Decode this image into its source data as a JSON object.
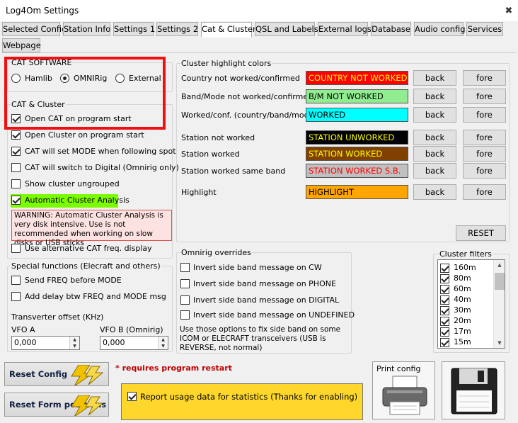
{
  "window": {
    "title": "Log4Om Settings",
    "close_glyph": "✖"
  },
  "tabs": [
    {
      "label": "Selected Config"
    },
    {
      "label": "Station Info"
    },
    {
      "label": "Settings 1"
    },
    {
      "label": "Settings 2"
    },
    {
      "label": "Cat & Cluster",
      "active": true
    },
    {
      "label": "QSL and Labels"
    },
    {
      "label": "External logs"
    },
    {
      "label": "Database"
    },
    {
      "label": "Audio config"
    },
    {
      "label": "Services"
    },
    {
      "label": "Webpage"
    }
  ],
  "cat_software": {
    "title": "CAT SOFTWARE",
    "options": [
      {
        "label": "Hamlib",
        "selected": false
      },
      {
        "label": "OMNIRig",
        "selected": true
      },
      {
        "label": "External",
        "selected": false
      }
    ]
  },
  "cat_cluster": {
    "title": "CAT & Cluster",
    "options": [
      {
        "label": "Open CAT on program start",
        "checked": true
      },
      {
        "label": "Open Cluster on program start",
        "checked": true
      },
      {
        "label": "CAT will set MODE when following spot",
        "checked": true
      },
      {
        "label": "CAT will switch to Digital (Omnirig only)",
        "checked": false
      },
      {
        "label": "Show cluster ungrouped",
        "checked": false
      },
      {
        "label": "Automatic Cluster Analysis",
        "checked": true
      }
    ],
    "warning": "WARNING: Automatic Cluster Analysis is very disk intensive. Use is not recommended when working on slow disks or USB sticks",
    "alt_freq": {
      "label": "Use alternative CAT freq. display",
      "checked": false
    }
  },
  "special": {
    "title": "Special functions (Elecraft and others)",
    "options": [
      {
        "label": "Send FREQ before MODE",
        "checked": false
      },
      {
        "label": "Add delay btw FREQ and MODE msg",
        "checked": false
      }
    ],
    "transverter_label": "Transverter offset (KHz)",
    "vfo_a_label": "VFO A",
    "vfo_a_value": "0,000",
    "vfo_b_label": "VFO B (Omnirig)",
    "vfo_b_value": "0,000"
  },
  "highlight": {
    "title": "Cluster highlight colors",
    "back_label": "back",
    "fore_label": "fore",
    "reset_label": "RESET",
    "rows": [
      {
        "label": "Country not worked/confirmed",
        "sample": "COUNTRY NOT WORKED",
        "bg": "#ff0000",
        "fg": "#ffff00"
      },
      {
        "label": "Band/Mode not worked/confirmed",
        "sample": "B/M NOT WORKED",
        "bg": "#90ee90",
        "fg": "#000000"
      },
      {
        "label": "Worked/conf. (country/band/mode)",
        "sample": "WORKED",
        "bg": "#00ffff",
        "fg": "#000000"
      },
      {
        "label": "Station not worked",
        "sample": "STATION UNWORKED",
        "bg": "#000000",
        "fg": "#ffff00"
      },
      {
        "label": "Station worked",
        "sample": "STATION WORKED",
        "bg": "#804000",
        "fg": "#ffff00"
      },
      {
        "label": "Station worked same band",
        "sample": "STATION WORKED S.B.",
        "bg": "#c0c0c0",
        "fg": "#ff0000"
      },
      {
        "label": "Highlight",
        "sample": "HIGHLIGHT",
        "bg": "#ffa500",
        "fg": "#000000"
      }
    ]
  },
  "omnirig": {
    "title": "Omnirig overrides",
    "options": [
      {
        "label": "Invert side band message on CW",
        "checked": false
      },
      {
        "label": "Invert side band message on PHONE",
        "checked": false
      },
      {
        "label": "Invert side band message on DIGITAL",
        "checked": false
      },
      {
        "label": "Invert side band message on UNDEFINED",
        "checked": false
      }
    ],
    "note": "Use those options to fix side band on some ICOM or ELECRAFT transceivers (USB is REVERSE, not normal)"
  },
  "filters": {
    "title": "Cluster filters",
    "items": [
      {
        "label": "160m",
        "checked": true
      },
      {
        "label": "80m",
        "checked": true
      },
      {
        "label": "60m",
        "checked": true
      },
      {
        "label": "40m",
        "checked": true
      },
      {
        "label": "30m",
        "checked": true
      },
      {
        "label": "20m",
        "checked": true
      },
      {
        "label": "17m",
        "checked": true
      },
      {
        "label": "15m",
        "checked": true
      }
    ]
  },
  "footer": {
    "reset_config": "Reset Config",
    "reset_form": "Reset Form positions",
    "restart_note": "* requires program restart",
    "report_label": "Report usage data for statistics (Thanks for enabling)",
    "report_checked": true,
    "print_label": "Print config"
  },
  "colors": {
    "accent_outline": "#e11111",
    "auto_cluster_bg": "#7cfc00",
    "report_bg": "#ffd72a"
  }
}
